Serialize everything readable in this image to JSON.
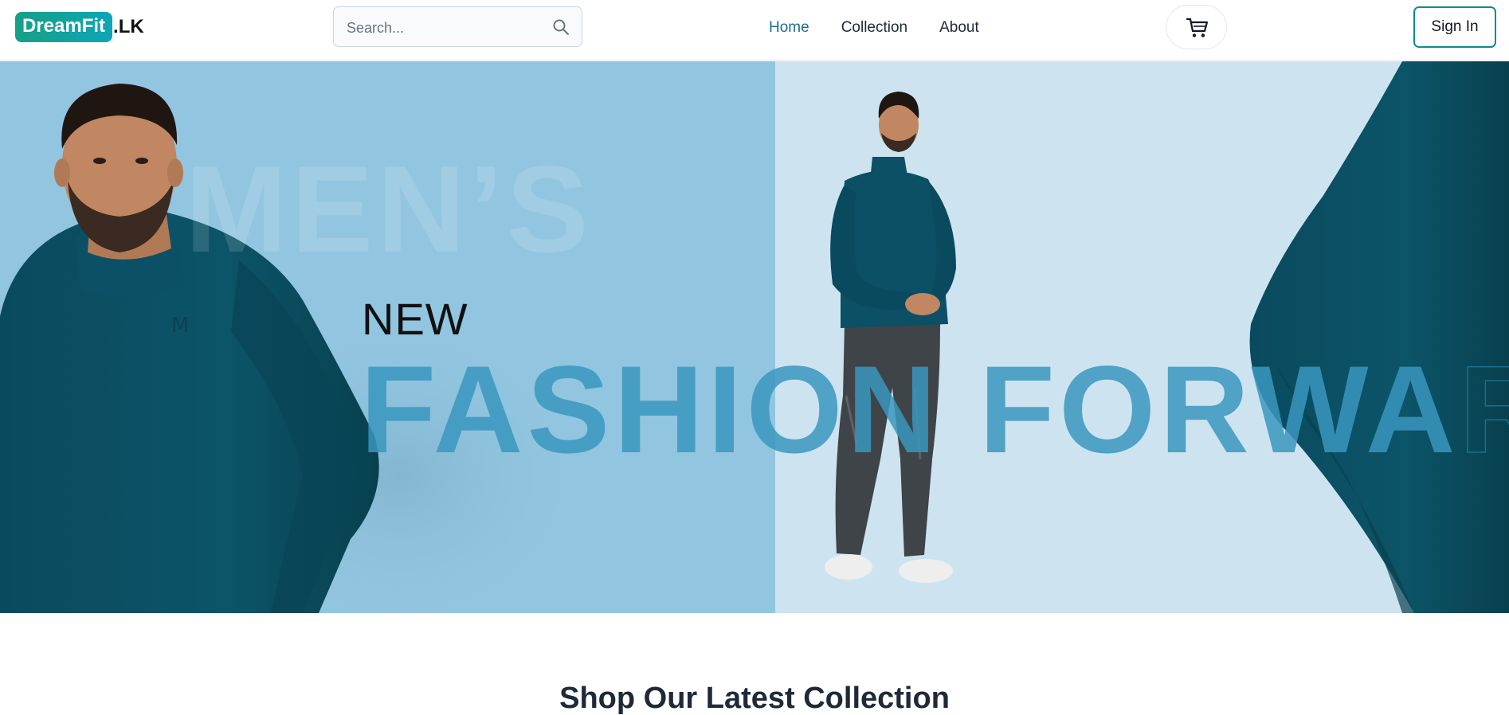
{
  "brand": {
    "badge": "DreamFit",
    "suffix": ".LK"
  },
  "search": {
    "placeholder": "Search..."
  },
  "nav": {
    "links": [
      "Home",
      "Collection",
      "About"
    ],
    "active": "Home"
  },
  "header": {
    "signin_label": "Sign In"
  },
  "hero": {
    "word_mens": "MEN’S",
    "word_new": "NEW",
    "word_fashion": "FASHION",
    "word_forward_solid": "FORWA",
    "word_forward_outline": "RD",
    "colors": {
      "left_panel": "#92c5e0",
      "right_panel": "#cde4f0",
      "shirt": "#0b4f63",
      "accent": "#3a96be"
    }
  },
  "section": {
    "title": "Shop Our Latest Collection"
  },
  "icons": [
    "search-icon",
    "cart-icon"
  ]
}
